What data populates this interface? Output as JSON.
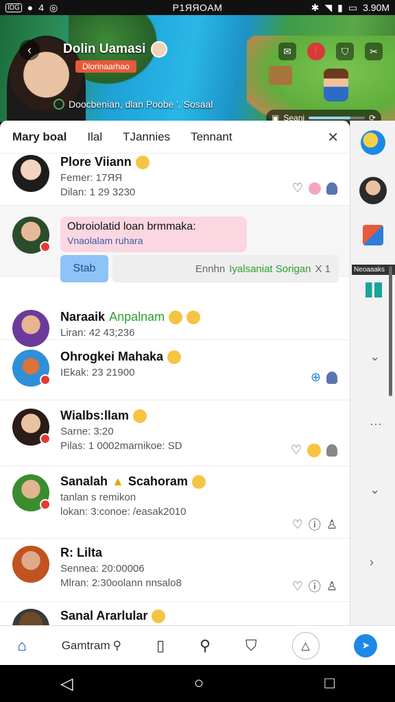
{
  "status_bar": {
    "left_icons": [
      "IDG",
      "●",
      "4",
      "◎"
    ],
    "time": "P1ЯЯOAM",
    "battery": "3.90M"
  },
  "stream": {
    "streamer_name": "Dolin Uamasi",
    "tag": "Dlorinaarhao",
    "subtitle": "Doocbenian, dlan Poobe ', Sosaal",
    "progress_label": "Seani",
    "progress_fraction": 0.75
  },
  "tabs": {
    "items": [
      "Mary boal",
      "Ilal",
      "TJannies",
      "Tennant"
    ],
    "close_glyph": "✕"
  },
  "chats": [
    {
      "name": "Plore Viiann",
      "line1": "Femer: 17ЯЯ",
      "line2": "Dilan: 1 29 3230"
    },
    {
      "bubble_text": "Obroiolatid loan brmmaka:",
      "bubble_sub": "Vnaolalam ruhara",
      "reply_label": "Stab",
      "reply_input_prefix": "Ennhn",
      "reply_input_green": "Iyalsaniat Sorigan",
      "reply_input_suffix": "X 1"
    },
    {
      "name": "Naraaik",
      "name_green": "Anpalnam",
      "line1": "Liran: 42 43;236"
    },
    {
      "name": "Ohrogkei Mahaka",
      "line1": "IEkak: 23 21900"
    },
    {
      "name": "Wialbs:llam",
      "line1": "Sarne: 3:20",
      "line2": "Pilas: 1 0002marnikoe: SD"
    },
    {
      "name": "Sanalah",
      "name_after": "Scahoram",
      "line1": "tanlan s remikon",
      "line2": "lokan: 3:conoe: /easak2010"
    },
    {
      "name": "R: Lilta",
      "line1": "Sennea: 20:00006",
      "line2": "Mlran: 2:30oolann nnsalo8"
    },
    {
      "name": "Sanal Ararlular"
    }
  ],
  "rail": {
    "label": "Neoaaaks"
  },
  "bottom_nav": {
    "label": "Gamtram"
  }
}
